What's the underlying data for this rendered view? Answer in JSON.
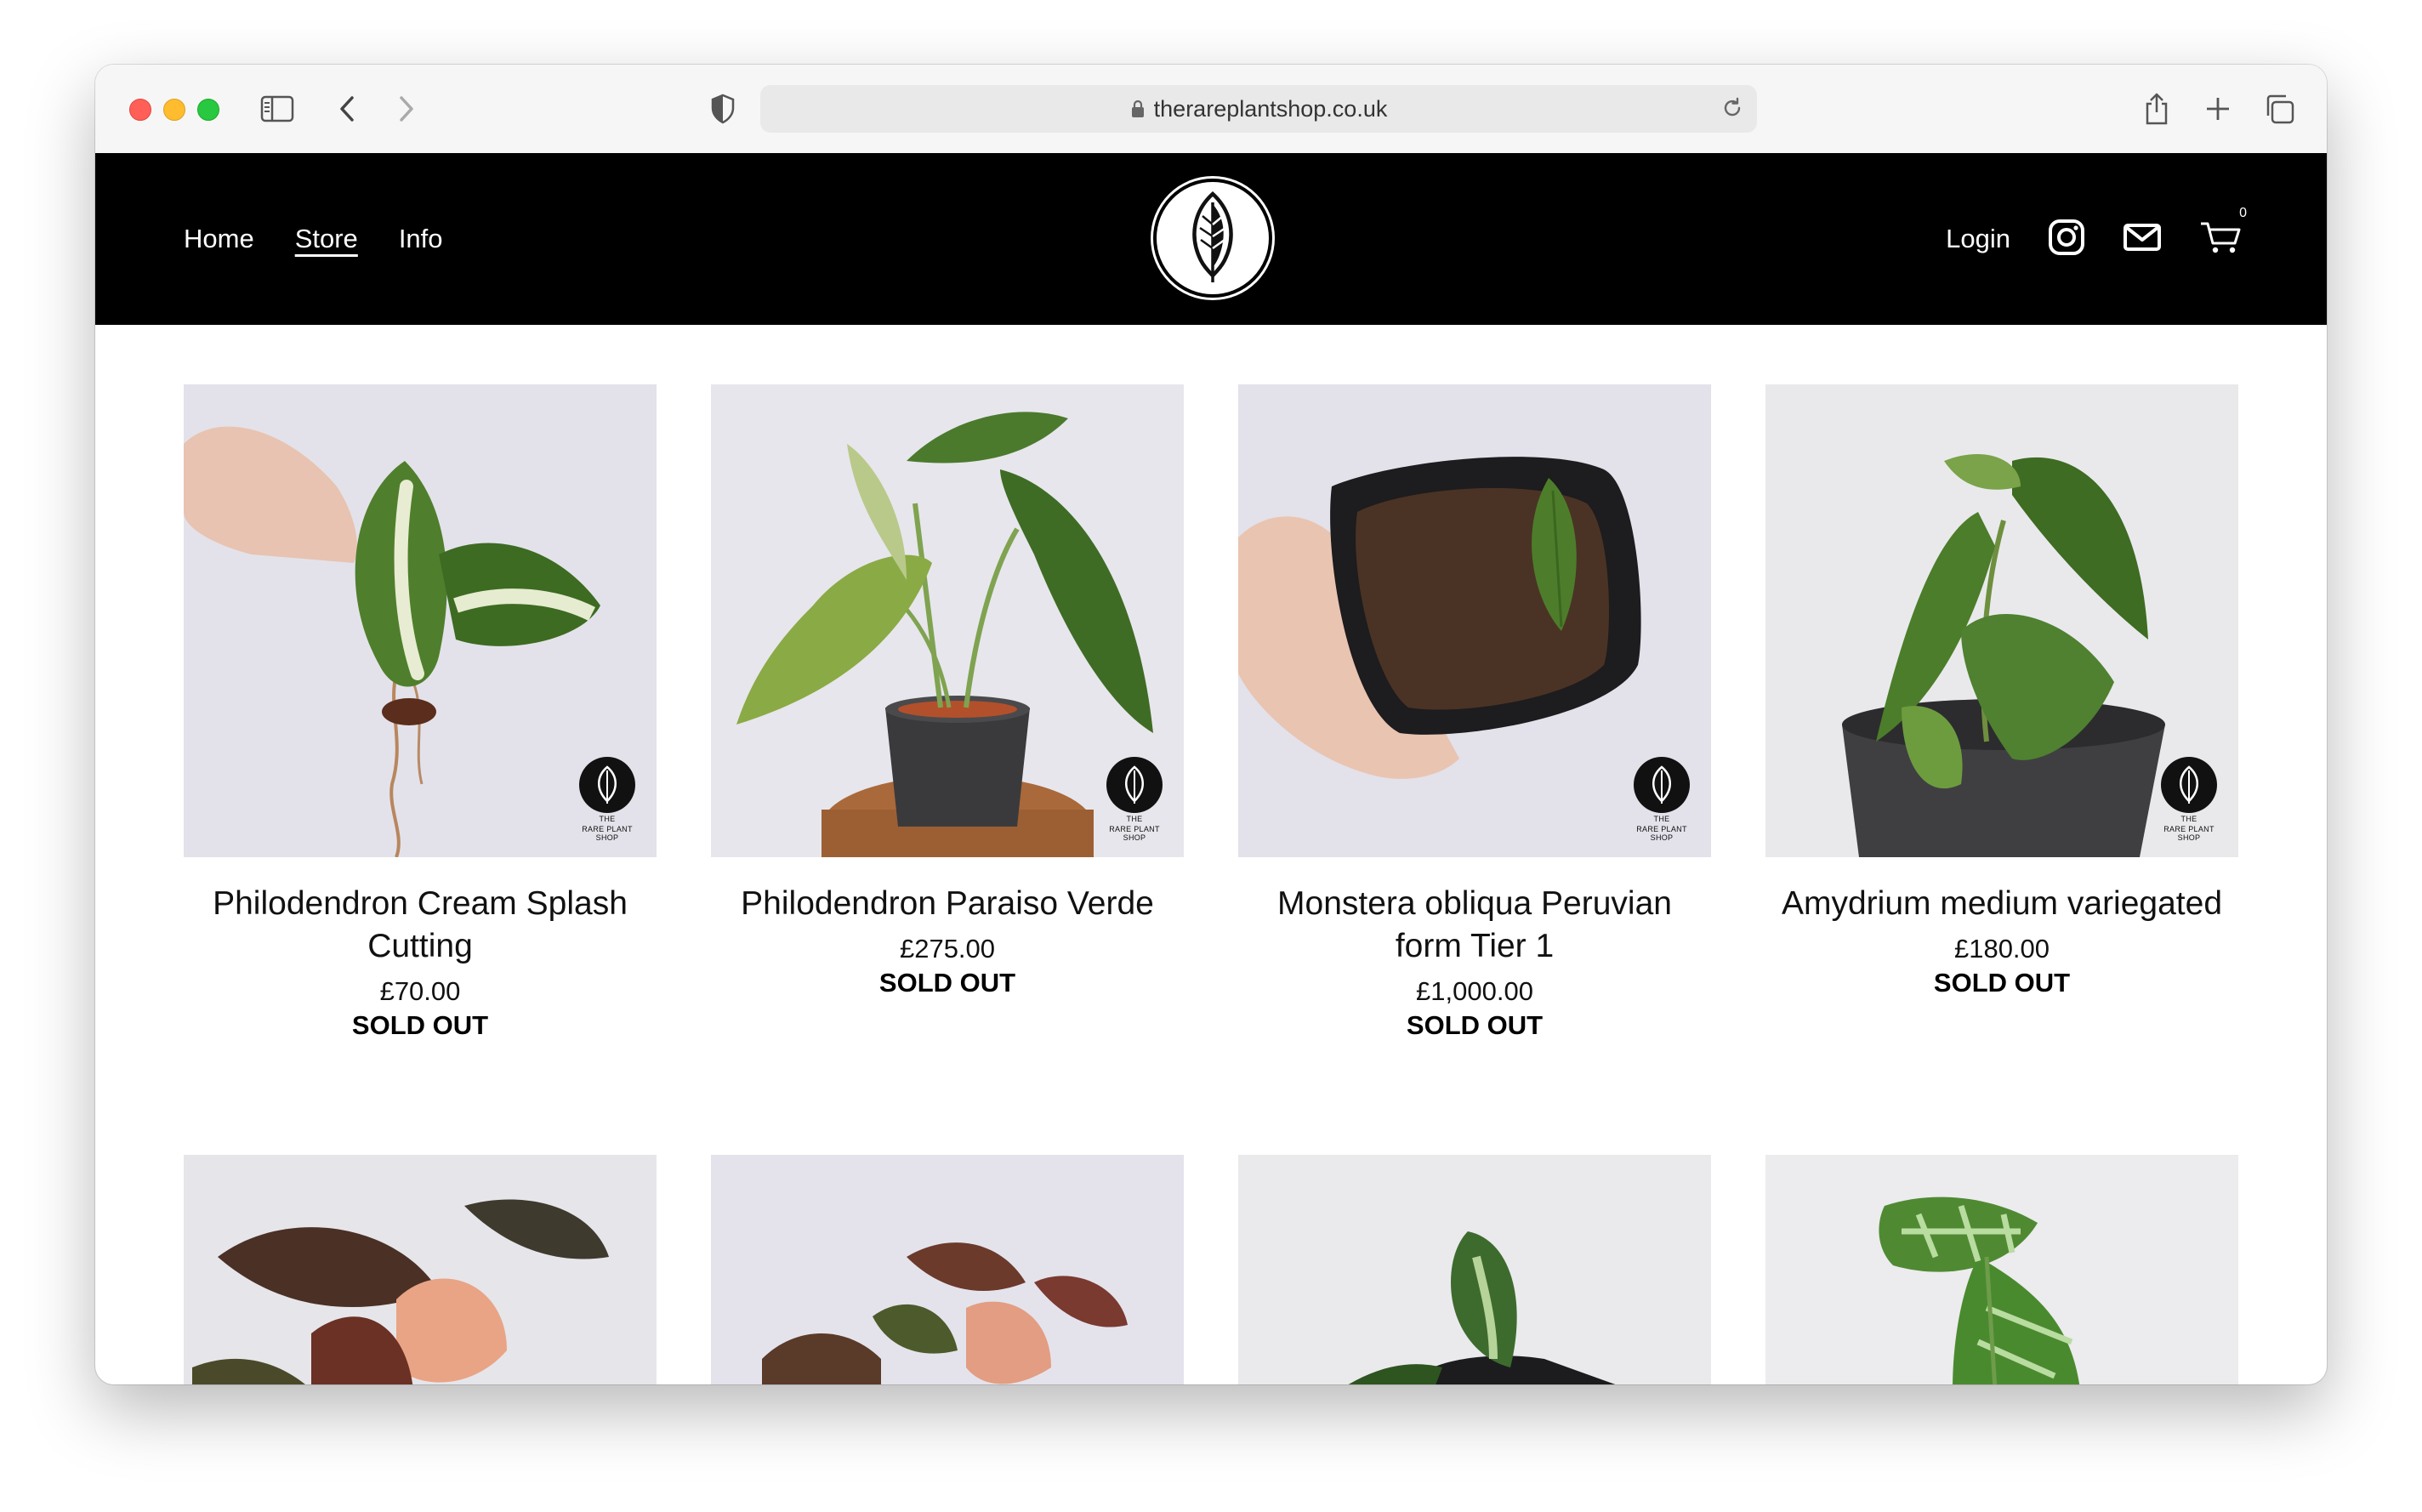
{
  "browser": {
    "url": "therareplantshop.co.uk"
  },
  "header": {
    "nav": [
      "Home",
      "Store",
      "Info"
    ],
    "active_nav": "Store",
    "login": "Login",
    "cart_count": "0"
  },
  "products": [
    {
      "title": "Philodendron Cream Splash Cutting",
      "price": "£70.00",
      "status": "SOLD OUT"
    },
    {
      "title": "Philodendron Paraiso Verde",
      "price": "£275.00",
      "status": "SOLD OUT"
    },
    {
      "title": "Monstera obliqua Peruvian form Tier 1",
      "price": "£1,000.00",
      "status": "SOLD OUT"
    },
    {
      "title": "Amydrium medium variegated",
      "price": "£180.00",
      "status": "SOLD OUT"
    }
  ],
  "badge_text": "RARE PLANT SHOP",
  "badge_prefix": "THE",
  "colors": {
    "header_bg": "#000000",
    "page_bg": "#ffffff",
    "photo_bg": "#e4e3ea"
  }
}
